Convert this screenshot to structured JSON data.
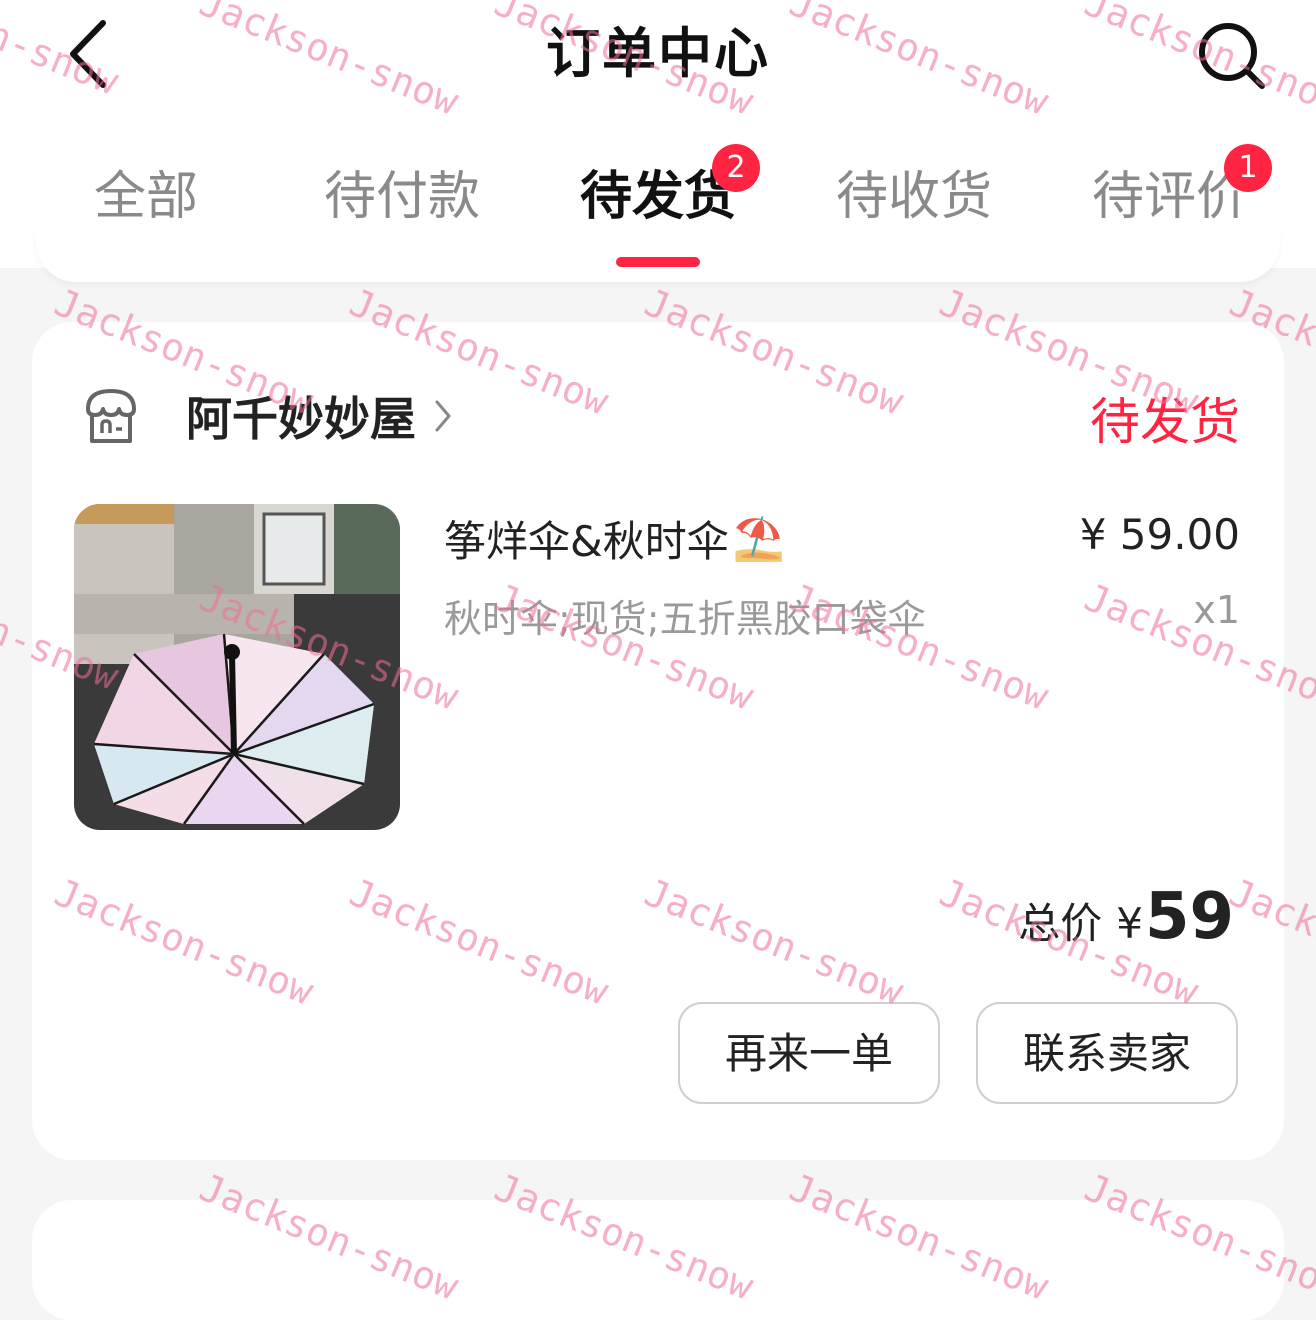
{
  "header": {
    "title": "订单中心"
  },
  "tabs": [
    {
      "label": "全部",
      "badge": ""
    },
    {
      "label": "待付款",
      "badge": ""
    },
    {
      "label": "待发货",
      "badge": "2"
    },
    {
      "label": "待收货",
      "badge": ""
    },
    {
      "label": "待评价",
      "badge": "1"
    }
  ],
  "order": {
    "shop_name": "阿千妙妙屋",
    "status": "待发货",
    "product": {
      "title": "筝烊伞&秋时伞",
      "title_emoji": "⛱️",
      "spec": "秋时伞;现货;五折黑胶口袋伞",
      "price": "¥ 59.00",
      "quantity": "x1"
    },
    "total_label": "总价",
    "total_currency": "¥",
    "total_value": "59",
    "buttons": {
      "reorder": "再来一单",
      "contact_seller": "联系卖家"
    }
  },
  "watermark_text": "Jackson-snow",
  "colors": {
    "accent": "#ff2442",
    "background": "#f5f5f5"
  }
}
